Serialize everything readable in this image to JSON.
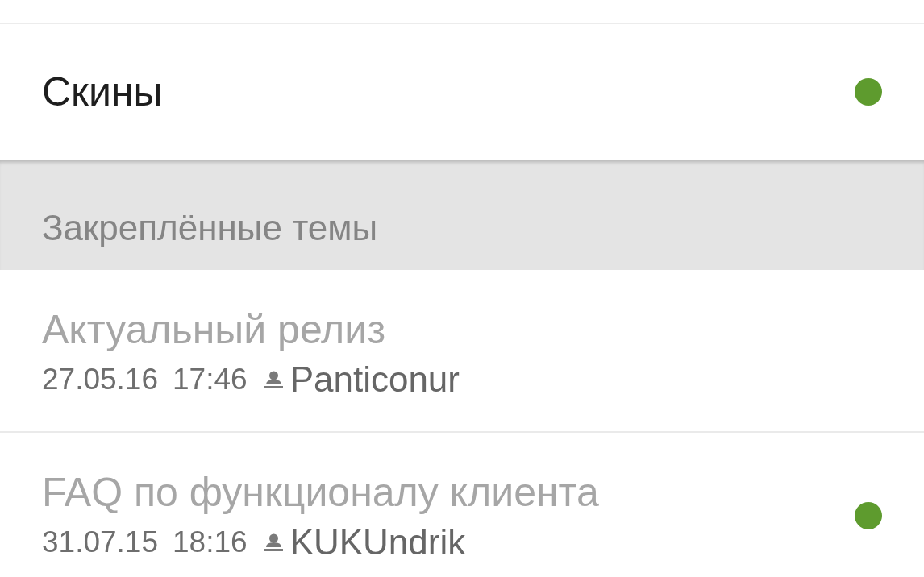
{
  "forum": {
    "title": "Скины",
    "unread": true
  },
  "pinned_section": {
    "title": "Закреплённые темы"
  },
  "topics": [
    {
      "title": "Актуальный релиз",
      "date": "27.05.16",
      "time": "17:46",
      "author": "Panticonur",
      "unread": false
    },
    {
      "title": "FAQ по функционалу клиента",
      "date": "31.07.15",
      "time": "18:16",
      "author": "KUKUndrik",
      "unread": true
    }
  ]
}
